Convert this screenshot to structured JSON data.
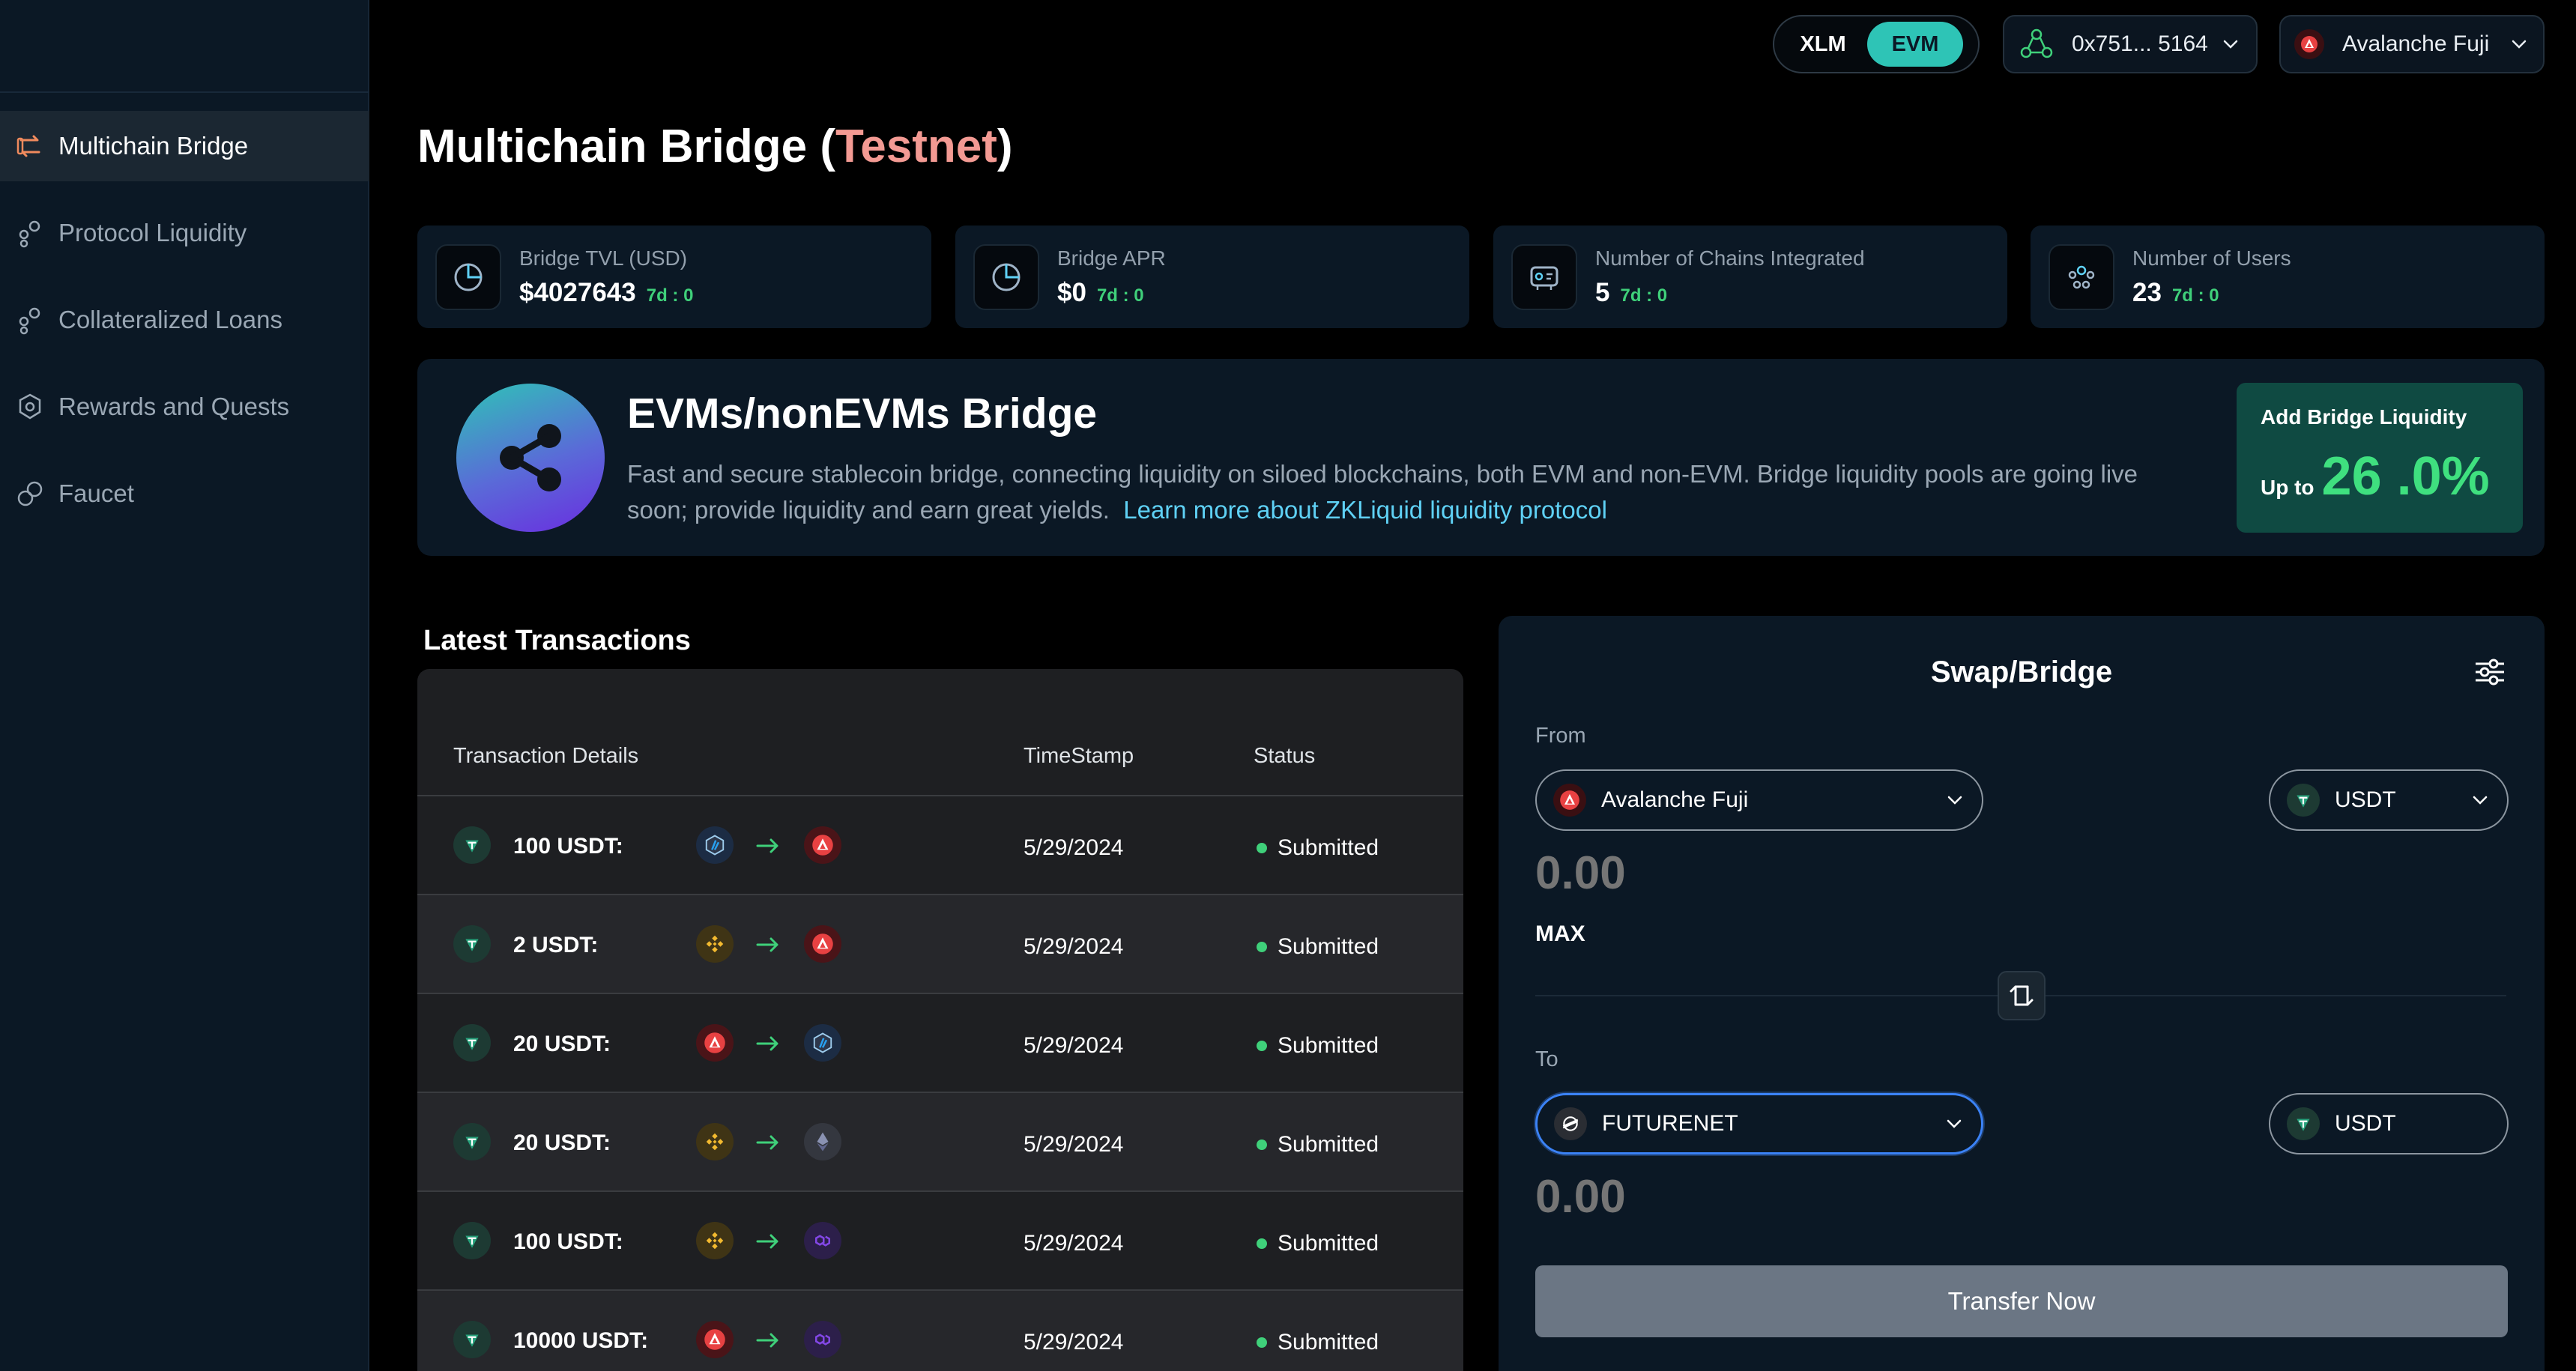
{
  "sidebar": {
    "items": [
      {
        "label": "Multichain Bridge",
        "icon": "bridge-icon",
        "active": true
      },
      {
        "label": "Protocol Liquidity",
        "icon": "liquidity-icon"
      },
      {
        "label": "Collateralized Loans",
        "icon": "loans-icon"
      },
      {
        "label": "Rewards and Quests",
        "icon": "rewards-icon"
      },
      {
        "label": "Faucet",
        "icon": "faucet-icon"
      }
    ]
  },
  "topbar": {
    "toggle": {
      "xlm": "XLM",
      "evm": "EVM",
      "selected": "EVM"
    },
    "wallet": "0x751... 5164",
    "chain": "Avalanche Fuji"
  },
  "page": {
    "title_main": "Multichain Bridge (",
    "title_accent": "Testnet",
    "title_end": ")"
  },
  "stats": [
    {
      "label": "Bridge TVL (USD)",
      "value": "$4027643",
      "delta": "7d : 0",
      "icon": "pie-chart-icon"
    },
    {
      "label": "Bridge APR",
      "value": "$0",
      "delta": "7d : 0",
      "icon": "pie-chart-icon"
    },
    {
      "label": "Number of Chains Integrated",
      "value": "5",
      "delta": "7d : 0",
      "icon": "chains-icon"
    },
    {
      "label": "Number of Users",
      "value": "23",
      "delta": "7d : 0",
      "icon": "users-icon"
    }
  ],
  "banner": {
    "title": "EVMs/nonEVMs Bridge",
    "desc_line1": "Fast and secure stablecoin bridge, connecting liquidity on siloed blockchains, both EVM and non-EVM. Bridge liquidity pools are going live",
    "desc_line2": "soon; provide liquidity and earn great yields.",
    "link": "Learn more about ZKLiquid liquidity protocol",
    "liquidity": {
      "title": "Add Bridge Liquidity",
      "upto": "Up to",
      "value": "26 .0%"
    }
  },
  "transactions": {
    "heading": "Latest Transactions",
    "columns": [
      "Transaction Details",
      "TimeStamp",
      "Status"
    ],
    "rows": [
      {
        "amount": "100 USDT:",
        "from": "arbitrum",
        "to": "avalanche",
        "timestamp": "5/29/2024",
        "status": "Submitted"
      },
      {
        "amount": "2 USDT:",
        "from": "bnb",
        "to": "avalanche",
        "timestamp": "5/29/2024",
        "status": "Submitted"
      },
      {
        "amount": "20 USDT:",
        "from": "avalanche",
        "to": "arbitrum",
        "timestamp": "5/29/2024",
        "status": "Submitted"
      },
      {
        "amount": "20 USDT:",
        "from": "bnb",
        "to": "ethereum",
        "timestamp": "5/29/2024",
        "status": "Submitted"
      },
      {
        "amount": "100 USDT:",
        "from": "bnb",
        "to": "polygon",
        "timestamp": "5/29/2024",
        "status": "Submitted"
      },
      {
        "amount": "10000 USDT:",
        "from": "avalanche",
        "to": "polygon",
        "timestamp": "5/29/2024",
        "status": "Submitted"
      }
    ]
  },
  "swap": {
    "title": "Swap/Bridge",
    "from_label": "From",
    "from_chain": "Avalanche Fuji",
    "from_token": "USDT",
    "from_amount_placeholder": "0.00",
    "max": "MAX",
    "to_label": "To",
    "to_chain": "FUTURENET",
    "to_token": "USDT",
    "to_amount_placeholder": "0.00",
    "transfer": "Transfer Now"
  },
  "colors": {
    "accent_teal": "#2ec4b6",
    "testnet_pink": "#f39a93",
    "success_green": "#3fd07a",
    "link_blue": "#5fd1f5"
  }
}
